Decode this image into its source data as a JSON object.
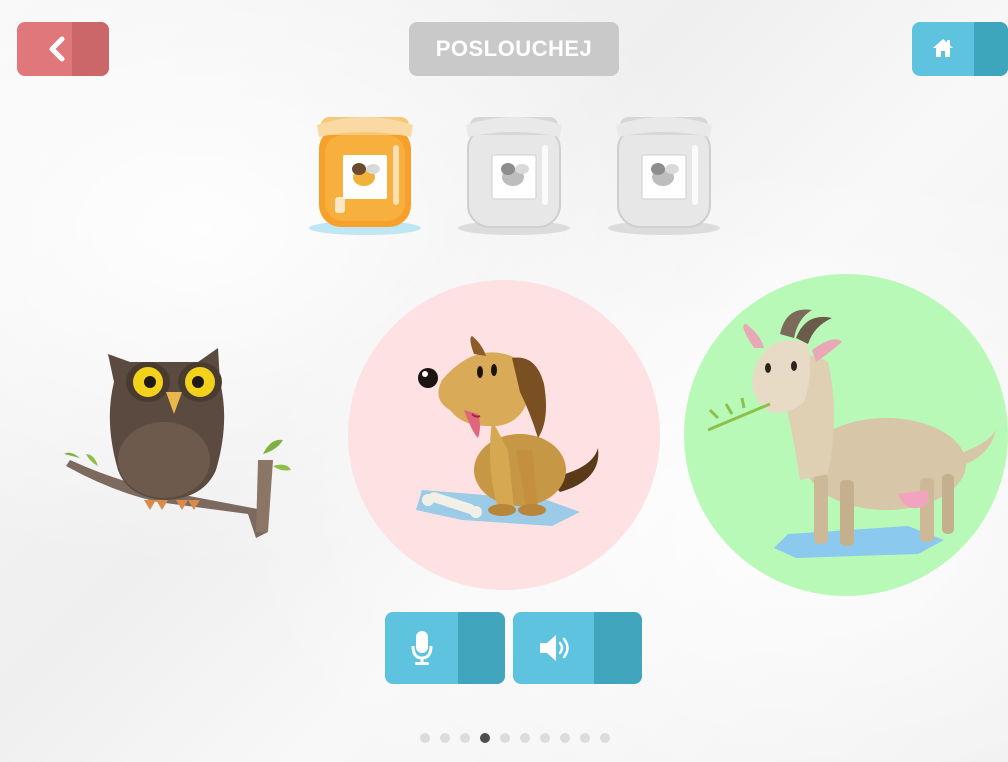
{
  "header": {
    "title": "POSLOUCHEJ",
    "back_icon": "chevron-left-icon",
    "home_icon": "home-icon"
  },
  "colors": {
    "back": "#e0787b",
    "title_bg": "#c9c9c9",
    "accent": "#5ec3de",
    "dog_circle": "#fde1e3",
    "goat_circle": "#b9f9b7",
    "honey": "#f7a12a"
  },
  "progress": {
    "jars": [
      {
        "name": "honey-jar-filled",
        "filled": true
      },
      {
        "name": "honey-jar-empty",
        "filled": false
      },
      {
        "name": "honey-jar-empty",
        "filled": false
      }
    ]
  },
  "animals": [
    {
      "name": "owl",
      "highlight": "none"
    },
    {
      "name": "dog",
      "highlight": "pink"
    },
    {
      "name": "goat",
      "highlight": "green"
    }
  ],
  "controls": {
    "mic_icon": "microphone-icon",
    "speaker_icon": "speaker-icon"
  },
  "pagination": {
    "total": 10,
    "current": 4
  }
}
